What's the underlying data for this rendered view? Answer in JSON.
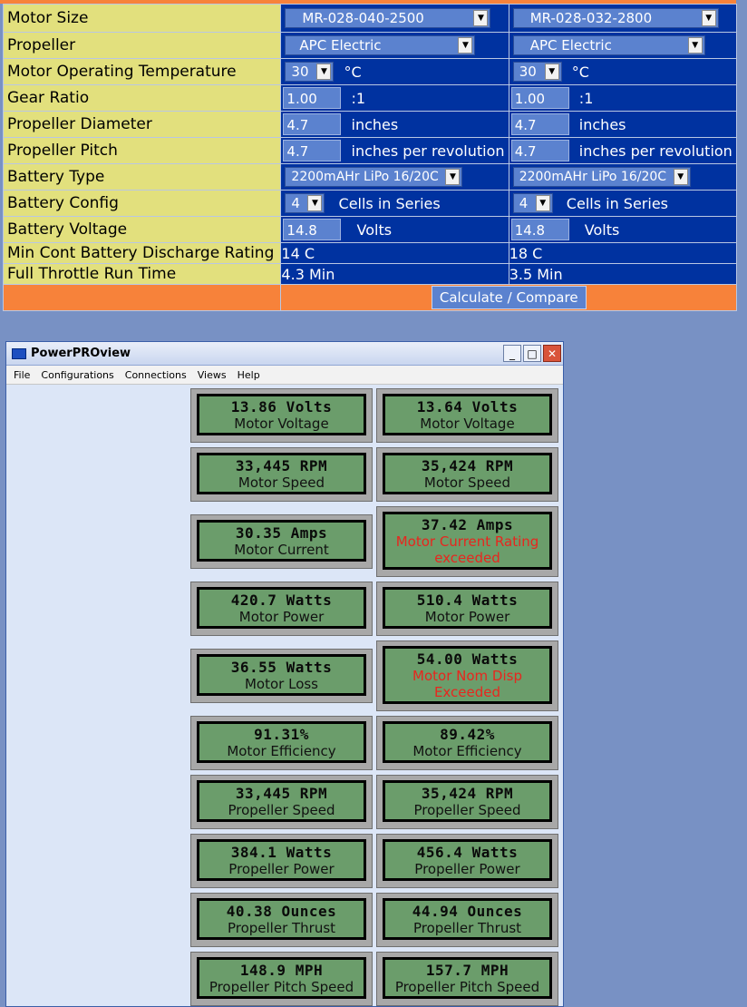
{
  "config_rows": [
    {
      "label": "Motor Size",
      "a": "MR-028-040-2500",
      "b": "MR-028-032-2800"
    },
    {
      "label": "Propeller",
      "a": "APC Electric",
      "b": "APC Electric"
    },
    {
      "label": "Motor Operating Temperature",
      "a": "30",
      "b": "30",
      "unit": "°C"
    },
    {
      "label": "Gear Ratio",
      "a": "1.00",
      "b": "1.00",
      "unit": ":1"
    },
    {
      "label": "Propeller Diameter",
      "a": "4.7",
      "b": "4.7",
      "unit": "inches"
    },
    {
      "label": "Propeller Pitch",
      "a": "4.7",
      "b": "4.7",
      "unit": "inches per revolution"
    },
    {
      "label": "Battery Type",
      "a": "2200mAHr LiPo 16/20C",
      "b": "2200mAHr LiPo 16/20C"
    },
    {
      "label": "Battery Config",
      "a": "4",
      "b": "4",
      "unit": "Cells in Series"
    },
    {
      "label": "Battery Voltage",
      "a": "14.8",
      "b": "14.8",
      "unit": "Volts"
    },
    {
      "label": "Min Cont Battery Discharge Rating",
      "a": "14 C",
      "b": "18 C"
    },
    {
      "label": "Full Throttle Run Time",
      "a": "4.3 Min",
      "b": "3.5 Min"
    }
  ],
  "calculate_label": "Calculate / Compare",
  "window": {
    "title": "PowerPROview",
    "menu": [
      "File",
      "Configurations",
      "Connections",
      "Views",
      "Help"
    ]
  },
  "meters": [
    {
      "a": {
        "value": "13.86 Volts",
        "label": "Motor Voltage"
      },
      "b": {
        "value": "13.64 Volts",
        "label": "Motor Voltage"
      }
    },
    {
      "a": {
        "value": "33,445 RPM",
        "label": "Motor Speed"
      },
      "b": {
        "value": "35,424 RPM",
        "label": "Motor Speed"
      }
    },
    {
      "a": {
        "value": "30.35 Amps",
        "label": "Motor Current"
      },
      "b": {
        "value": "37.42 Amps",
        "label": "Motor Current Rating",
        "label2": "exceeded"
      }
    },
    {
      "a": {
        "value": "420.7 Watts",
        "label": "Motor Power"
      },
      "b": {
        "value": "510.4 Watts",
        "label": "Motor Power"
      }
    },
    {
      "a": {
        "value": "36.55 Watts",
        "label": "Motor Loss"
      },
      "b": {
        "value": "54.00 Watts",
        "label": "Motor Nom Disp",
        "label2": "Exceeded"
      }
    },
    {
      "a": {
        "value": "91.31%",
        "label": "Motor Efficiency"
      },
      "b": {
        "value": "89.42%",
        "label": "Motor Efficiency"
      }
    },
    {
      "a": {
        "value": "33,445 RPM",
        "label": "Propeller Speed"
      },
      "b": {
        "value": "35,424 RPM",
        "label": "Propeller Speed"
      }
    },
    {
      "a": {
        "value": "384.1 Watts",
        "label": "Propeller Power"
      },
      "b": {
        "value": "456.4 Watts",
        "label": "Propeller Power"
      }
    },
    {
      "a": {
        "value": "40.38 Ounces",
        "label": "Propeller Thrust"
      },
      "b": {
        "value": "44.94 Ounces",
        "label": "Propeller Thrust"
      }
    },
    {
      "a": {
        "value": "148.9 MPH",
        "label": "Propeller Pitch Speed"
      },
      "b": {
        "value": "157.7 MPH",
        "label": "Propeller Pitch Speed"
      }
    }
  ],
  "colors": {
    "label_bg": "#e2e07d",
    "value_bg": "#0032a0",
    "accent": "#f7823a",
    "lcd_screen": "#6b9d6b",
    "warning_text": "#e8261e"
  }
}
